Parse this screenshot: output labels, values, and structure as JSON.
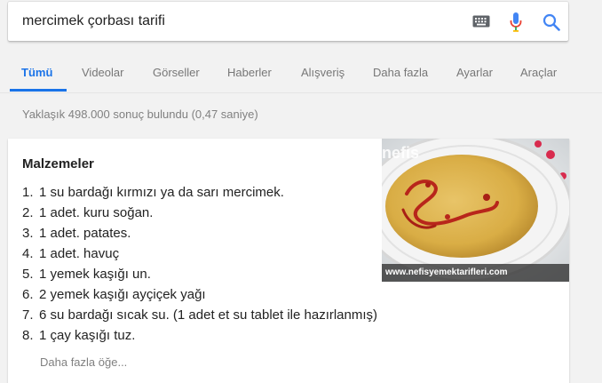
{
  "search": {
    "query": "mercimek çorbası tarifi",
    "keyboard_icon": "keyboard-icon",
    "mic_icon": "microphone-icon",
    "search_icon": "search-icon"
  },
  "tabs": [
    {
      "label": "Tümü",
      "active": true
    },
    {
      "label": "Videolar",
      "active": false
    },
    {
      "label": "Görseller",
      "active": false
    },
    {
      "label": "Haberler",
      "active": false
    },
    {
      "label": "Alışveriş",
      "active": false
    },
    {
      "label": "Daha fazla",
      "active": false
    },
    {
      "label": "Ayarlar",
      "active": false
    },
    {
      "label": "Araçlar",
      "active": false
    }
  ],
  "result_stats": "Yaklaşık 498.000 sonuç bulundu (0,47 saniye)",
  "recipe_card": {
    "title": "Malzemeler",
    "ingredients": [
      {
        "num": "1.",
        "text": "1 su bardağı kırmızı ya da sarı mercimek."
      },
      {
        "num": "2.",
        "text": "1 adet. kuru soğan."
      },
      {
        "num": "3.",
        "text": "1 adet. patates."
      },
      {
        "num": "4.",
        "text": "1 adet. havuç"
      },
      {
        "num": "5.",
        "text": "1 yemek kaşığı un."
      },
      {
        "num": "6.",
        "text": "2 yemek kaşığı ayçiçek yağı"
      },
      {
        "num": "7.",
        "text": "6 su bardağı sıcak su. (1 adet et su tablet ile hazırlanmış)"
      },
      {
        "num": "8.",
        "text": "1 çay kaşığı tuz."
      }
    ],
    "more_link": "Daha fazla öğe...",
    "image": {
      "watermark": "nefis",
      "caption": "www.nefisyemektarifleri.com"
    }
  },
  "colors": {
    "accent": "#1a73e8",
    "muted_text": "#808080",
    "page_bg": "#f2f2f2"
  }
}
